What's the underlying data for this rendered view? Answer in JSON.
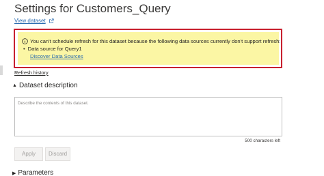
{
  "header": {
    "title": "Settings for Customers_Query",
    "view_dataset_label": "View dataset"
  },
  "warning": {
    "message": "You can't schedule refresh for this dataset because the following data sources currently don't support refresh:",
    "bullet": "Data source for Query1",
    "link_label": "Discover Data Sources",
    "border_color": "#c8202f",
    "background_color": "#fbf6a4",
    "icon": "info-circle-icon"
  },
  "refresh_history_label": "Refresh history",
  "description_section": {
    "title": "Dataset description",
    "placeholder": "Describe the contents of this dataset.",
    "value": "",
    "char_count": "500 characters left"
  },
  "actions": {
    "apply_label": "Apply",
    "discard_label": "Discard"
  },
  "parameters_section": {
    "title": "Parameters"
  },
  "colors": {
    "link": "#2b6cb0",
    "button_disabled_bg": "#f3f2f1",
    "button_disabled_text": "#a19f9d"
  }
}
